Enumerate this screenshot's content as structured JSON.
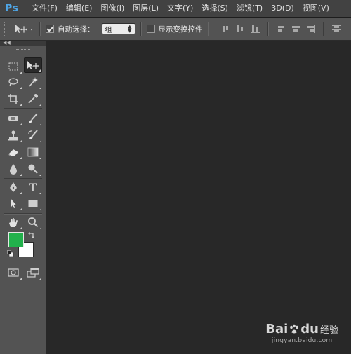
{
  "app": {
    "logo_text": "Ps",
    "brand_color": "#4fa6e6"
  },
  "menu": {
    "items": [
      {
        "label": "文件(F)"
      },
      {
        "label": "编辑(E)"
      },
      {
        "label": "图像(I)"
      },
      {
        "label": "图层(L)"
      },
      {
        "label": "文字(Y)"
      },
      {
        "label": "选择(S)"
      },
      {
        "label": "滤镜(T)"
      },
      {
        "label": "3D(D)"
      },
      {
        "label": "视图(V)"
      }
    ]
  },
  "options": {
    "auto_select": {
      "label": "自动选择：",
      "checked": true
    },
    "auto_select_target": {
      "value": "组"
    },
    "show_transform": {
      "label": "显示变换控件",
      "checked": false
    },
    "align_icons": [
      "align-top-icon",
      "align-vcenter-icon",
      "align-bottom-icon",
      "align-left-icon",
      "align-hcenter-icon",
      "align-right-icon",
      "distribute-top-icon"
    ]
  },
  "toolbar": {
    "tools": [
      {
        "name": "rectangular-marquee-tool",
        "icon": "marquee-icon"
      },
      {
        "name": "move-tool",
        "icon": "move-icon",
        "active": true
      },
      {
        "name": "lasso-tool",
        "icon": "lasso-icon"
      },
      {
        "name": "magic-wand-tool",
        "icon": "magic-wand-icon"
      },
      {
        "name": "crop-tool",
        "icon": "crop-icon"
      },
      {
        "name": "eyedropper-tool",
        "icon": "eyedropper-icon"
      },
      {
        "name": "spot-healing-tool",
        "icon": "healing-brush-icon"
      },
      {
        "name": "brush-tool",
        "icon": "brush-icon"
      },
      {
        "name": "clone-stamp-tool",
        "icon": "stamp-icon"
      },
      {
        "name": "history-brush-tool",
        "icon": "history-brush-icon"
      },
      {
        "name": "eraser-tool",
        "icon": "eraser-icon"
      },
      {
        "name": "gradient-tool",
        "icon": "gradient-icon"
      },
      {
        "name": "blur-tool",
        "icon": "blur-drop-icon"
      },
      {
        "name": "dodge-tool",
        "icon": "dodge-icon"
      },
      {
        "name": "pen-tool",
        "icon": "pen-icon"
      },
      {
        "name": "type-tool",
        "icon": "type-icon",
        "glyph": "T"
      },
      {
        "name": "path-selection-tool",
        "icon": "path-selection-icon"
      },
      {
        "name": "rectangle-tool",
        "icon": "rectangle-icon"
      },
      {
        "name": "hand-tool",
        "icon": "hand-icon"
      },
      {
        "name": "zoom-tool",
        "icon": "zoom-icon"
      }
    ],
    "foreground_color": "#22b14c",
    "background_color": "#ffffff"
  },
  "canvas": {
    "background": "#282828"
  },
  "watermark": {
    "brand": "Bai",
    "brand_suffix": "du",
    "product": "经验",
    "url": "jingyan.baidu.com"
  }
}
